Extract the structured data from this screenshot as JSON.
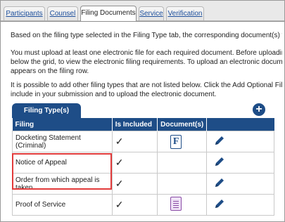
{
  "tabs": [
    {
      "label": "Participants",
      "active": false
    },
    {
      "label": "Counsel",
      "active": false
    },
    {
      "label": "Filing Documents",
      "active": true
    },
    {
      "label": "Service",
      "active": false
    },
    {
      "label": "Verification",
      "active": false
    }
  ],
  "paragraphs": {
    "p1": "Based on the filing type selected in the Filing Type tab, the corresponding document(s) that must",
    "p2_line1": "You must upload at least one electronic file for each required document. Before uploading, expan",
    "p2_line2": "below the grid, to view the electronic filing requirements. To upload an electronic document, click",
    "p2_line3": "appears on the filing row.",
    "p3_line1": "It is possible to add other filing types that are not listed below. Click the Add Optional Filing icon t",
    "p3_line2": "include in your submission and to upload the electronic document."
  },
  "grid": {
    "tab_label": "Filing Type(s)",
    "add_icon": "plus-circle-icon",
    "headers": [
      "Filing",
      "Is Included",
      "Document(s)",
      ""
    ],
    "rows": [
      {
        "filing": "Docketing Statement (Criminal)",
        "included": "✓",
        "document": "F",
        "document_icon": "form-document-icon",
        "edit_icon": "pencil-icon"
      },
      {
        "filing": "Notice of Appeal",
        "included": "✓",
        "document": "",
        "document_icon": "",
        "edit_icon": "pencil-icon"
      },
      {
        "filing": "Order from which appeal is taken",
        "included": "✓",
        "document": "",
        "document_icon": "",
        "edit_icon": "pencil-icon"
      },
      {
        "filing": "Proof of Service",
        "included": "✓",
        "document": "",
        "document_icon": "text-document-icon",
        "edit_icon": "pencil-icon"
      }
    ]
  },
  "colors": {
    "header_blue": "#1e4d87",
    "highlight_red": "#e23b3b"
  }
}
